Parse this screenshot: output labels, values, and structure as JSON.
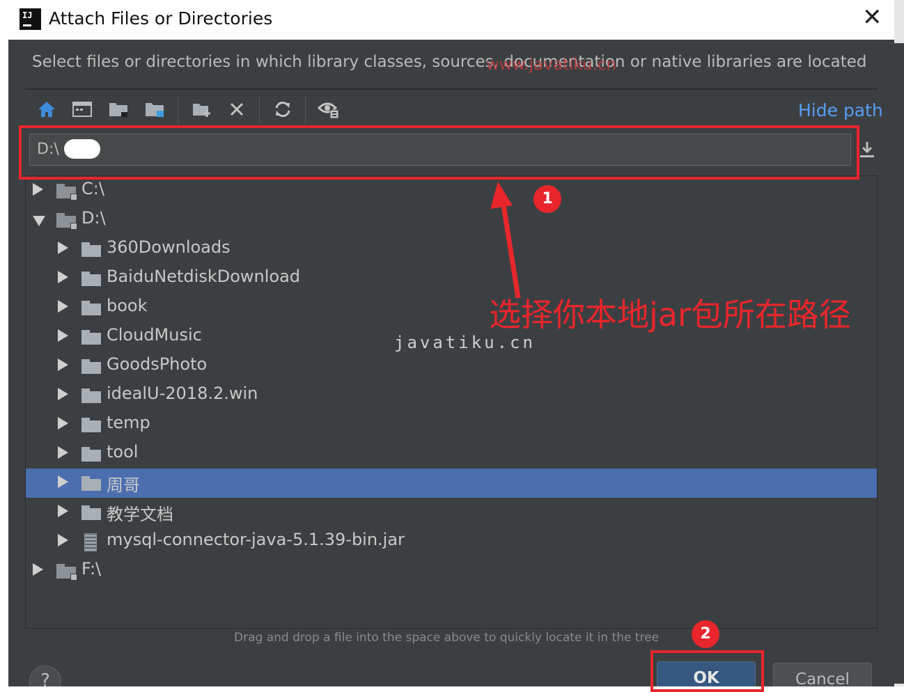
{
  "window": {
    "title": "Attach Files or Directories",
    "app_icon_text": "IJ"
  },
  "description": "Select files or directories in which library classes, sources, documentation or native libraries are located",
  "toolbar": {
    "icons": [
      "home-icon",
      "desktop-icon",
      "project-folder-icon",
      "module-folder-icon",
      "new-folder-icon",
      "delete-icon",
      "refresh-icon",
      "show-hidden-icon"
    ],
    "hide_path_label": "Hide path"
  },
  "path": {
    "value": "D:\\"
  },
  "tree": {
    "rows": [
      {
        "label": "C:\\",
        "kind": "drive",
        "depth": 0,
        "expanded": false,
        "selected": false
      },
      {
        "label": "D:\\",
        "kind": "drive",
        "depth": 0,
        "expanded": true,
        "selected": false
      },
      {
        "label": "360Downloads",
        "kind": "folder",
        "depth": 1,
        "expanded": false,
        "selected": false
      },
      {
        "label": "BaiduNetdiskDownload",
        "kind": "folder",
        "depth": 1,
        "expanded": false,
        "selected": false
      },
      {
        "label": "book",
        "kind": "folder",
        "depth": 1,
        "expanded": false,
        "selected": false
      },
      {
        "label": "CloudMusic",
        "kind": "folder",
        "depth": 1,
        "expanded": false,
        "selected": false
      },
      {
        "label": "GoodsPhoto",
        "kind": "folder",
        "depth": 1,
        "expanded": false,
        "selected": false
      },
      {
        "label": "idealU-2018.2.win",
        "kind": "folder",
        "depth": 1,
        "expanded": false,
        "selected": false
      },
      {
        "label": "temp",
        "kind": "folder",
        "depth": 1,
        "expanded": false,
        "selected": false
      },
      {
        "label": "tool",
        "kind": "folder",
        "depth": 1,
        "expanded": false,
        "selected": false
      },
      {
        "label": "周哥",
        "kind": "folder",
        "depth": 1,
        "expanded": false,
        "selected": true
      },
      {
        "label": "教学文档",
        "kind": "folder",
        "depth": 1,
        "expanded": false,
        "selected": false
      },
      {
        "label": "mysql-connector-java-5.1.39-bin.jar",
        "kind": "jar",
        "depth": 1,
        "expanded": false,
        "selected": false
      },
      {
        "label": "F:\\",
        "kind": "drive",
        "depth": 0,
        "expanded": false,
        "selected": false
      }
    ]
  },
  "hint": "Drag and drop a file into the space above to quickly locate it in the tree",
  "buttons": {
    "help": "?",
    "ok": "OK",
    "cancel": "Cancel"
  },
  "annotations": {
    "badge_1": "1",
    "badge_2": "2",
    "instruction": "选择你本地jar包所在路径",
    "watermark_top": "www.javatiku.cn",
    "watermark_mid": "javatiku.cn",
    "color": "#e8262c"
  },
  "colors": {
    "background": "#3c3f41",
    "selection": "#4b6eaf",
    "link": "#589df6",
    "ok_button": "#365880"
  }
}
